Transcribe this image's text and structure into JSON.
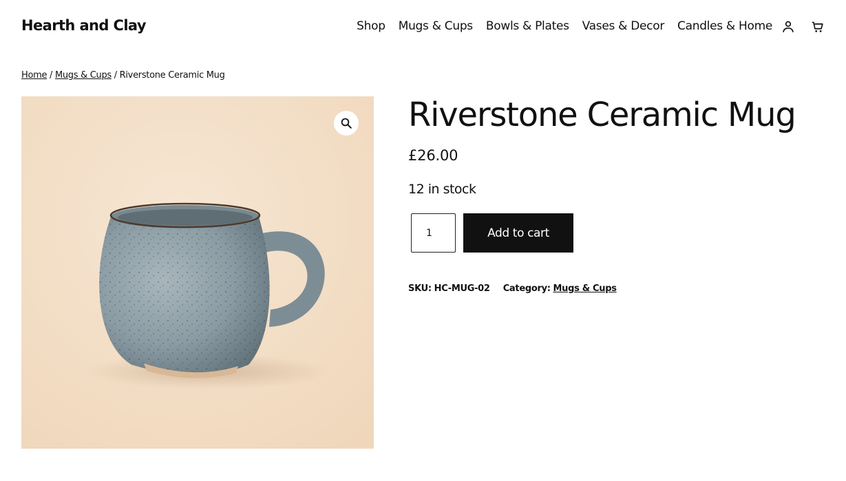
{
  "site": {
    "title": "Hearth and Clay"
  },
  "nav": {
    "items": [
      "Shop",
      "Mugs & Cups",
      "Bowls & Plates",
      "Vases & Decor",
      "Candles & Home"
    ],
    "account_icon": "user-icon",
    "cart_icon": "cart-icon"
  },
  "breadcrumb": {
    "home": "Home",
    "separator": " / ",
    "category": "Mugs & Cups",
    "current": "Riverstone Ceramic Mug"
  },
  "gallery": {
    "zoom_icon": "magnifier-icon",
    "background_color": "#f5e4cf",
    "mug_color": "#8a9ba3"
  },
  "product": {
    "title": "Riverstone Ceramic Mug",
    "price": "£26.00",
    "stock": "12 in stock",
    "quantity": "1",
    "add_to_cart_label": "Add to cart",
    "sku_label": "SKU:",
    "sku_value": "HC-MUG-02",
    "category_label": "Category:",
    "category_value": "Mugs & Cups"
  },
  "colors": {
    "text": "#111111",
    "button": "#111111",
    "button_text": "#ffffff"
  }
}
